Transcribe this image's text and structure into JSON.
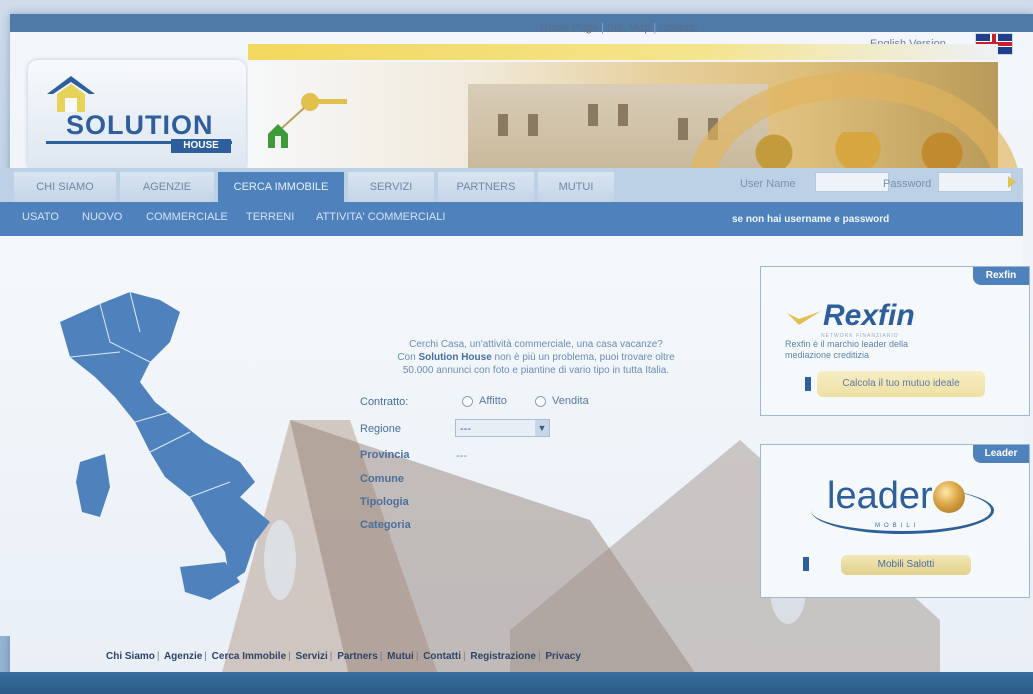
{
  "top_links": [
    "Home Page",
    "Site Map",
    "Contatti"
  ],
  "english_version": "English Version",
  "logo": {
    "main": "SOLUTION",
    "sub": "HOUSE"
  },
  "nav_tabs": [
    "CHI SIAMO",
    "AGENZIE",
    "CERCA IMMOBILE",
    "SERVIZI",
    "PARTNERS",
    "MUTUI"
  ],
  "active_tab_index": 2,
  "login": {
    "user_label": "User Name",
    "password_label": "Password"
  },
  "subnav": [
    "USATO",
    "NUOVO",
    "COMMERCIALE",
    "TERRENI",
    "ATTIVITA' COMMERCIALI"
  ],
  "subnav_right": "se non hai username e password",
  "intro": {
    "line1": "Cerchi Casa, un'attività commerciale, una casa vacanze?",
    "line2_prefix": "Con ",
    "line2_brand": "Solution House",
    "line2_suffix": " non è più un problema, puoi trovare oltre",
    "line3": "50.000 annunci con foto e piantine di vario tipo in tutta Italia."
  },
  "form": {
    "contratto_label": "Contratto:",
    "radio_options": [
      "Affitto",
      "Vendita"
    ],
    "regione_label": "Regione",
    "regione_value": "---",
    "provincia_label": "Provincia",
    "provincia_value": "---",
    "comune_label": "Comune",
    "tipologia_label": "Tipologia",
    "categoria_label": "Categoria"
  },
  "sidebar": {
    "rexfin": {
      "tab": "Rexfin",
      "logo": "Rexfin",
      "logo_sub": "NETWORK FINANZIARIO",
      "text": "Rexfin è il marchio leader della mediazione creditizia",
      "button": "Calcola il tuo mutuo ideale"
    },
    "leader": {
      "tab": "Leader",
      "logo": "leader",
      "logo_sub": "MOBILI",
      "button": "Mobili Salotti"
    }
  },
  "footer_links": [
    "Chi Siamo",
    "Agenzie",
    "Cerca Immobile",
    "Servizi",
    "Partners",
    "Mutui",
    "Contatti",
    "Registrazione",
    "Privacy"
  ],
  "colors": {
    "brand_blue": "#4f82bd",
    "logo_blue": "#2e5e9c",
    "gold": "#f2d85e"
  }
}
